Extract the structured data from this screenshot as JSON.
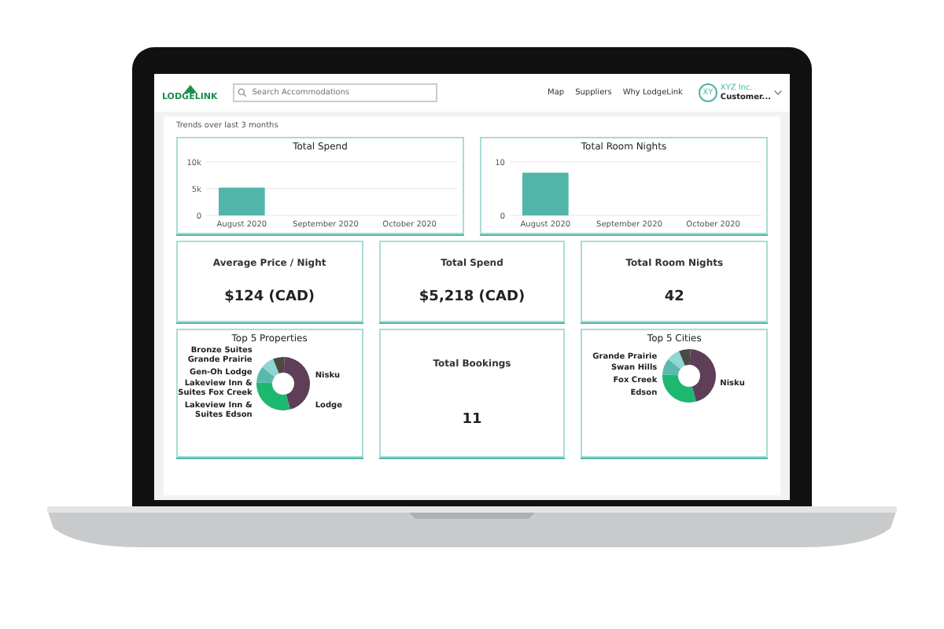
{
  "header": {
    "logo": "LODGELINK",
    "search": {
      "placeholder": "Search Accommodations"
    },
    "nav": [
      "Map",
      "Suppliers",
      "Why LodgeLink"
    ],
    "account": {
      "initials": "XY",
      "company": "XYZ Inc.",
      "role": "Customer..."
    }
  },
  "trends": {
    "title": "Trends over last 3 months",
    "charts": [
      {
        "chart_data": {
          "type": "bar",
          "title": "Total Spend",
          "categories": [
            "August 2020",
            "September 2020",
            "October 2020"
          ],
          "values": [
            5200,
            null,
            null
          ],
          "ylim": [
            0,
            10000
          ],
          "yticks": [
            {
              "value": 0,
              "label": "0"
            },
            {
              "value": 5000,
              "label": "5k"
            },
            {
              "value": 10000,
              "label": "10k"
            }
          ]
        }
      },
      {
        "chart_data": {
          "type": "bar",
          "title": "Total Room Nights",
          "categories": [
            "August 2020",
            "September 2020",
            "October 2020"
          ],
          "values": [
            8,
            null,
            null
          ],
          "ylim": [
            0,
            10
          ],
          "yticks": [
            {
              "value": 0,
              "label": "0"
            },
            {
              "value": 10,
              "label": "10"
            }
          ]
        }
      }
    ]
  },
  "kpis": [
    {
      "label": "Average Price / Night",
      "value": "$124 (CAD)"
    },
    {
      "label": "Total Spend",
      "value": "$5,218 (CAD)"
    },
    {
      "label": "Total Room Nights",
      "value": "42"
    }
  ],
  "bottom": [
    {
      "kind": "donut",
      "title": "Top 5 Properties",
      "items": [
        {
          "label": "Bronze Suites Grande Prairie",
          "color": "#4a4a42"
        },
        {
          "label": "Gen-Oh Lodge",
          "color": "#8fd6d6"
        },
        {
          "label": "Lakeview Inn & Suites Fox Creek",
          "color": "#5ab9ad"
        },
        {
          "label": "Lakeview Inn & Suites Edson",
          "color": "#1db86f"
        },
        {
          "label": "Nisku Lodge",
          "color": "#5e3f57"
        }
      ]
    },
    {
      "kind": "stat",
      "title": "Total Bookings",
      "value": "11"
    },
    {
      "kind": "donut",
      "title": "Top 5 Cities",
      "items": [
        {
          "label": "Grande Prairie",
          "color": "#4a4a42"
        },
        {
          "label": "Swan Hills",
          "color": "#8fd6d6"
        },
        {
          "label": "Fox Creek",
          "color": "#5ab9ad"
        },
        {
          "label": "Edson",
          "color": "#1db86f"
        },
        {
          "label": "Nisku",
          "color": "#5e3f57"
        }
      ]
    }
  ]
}
